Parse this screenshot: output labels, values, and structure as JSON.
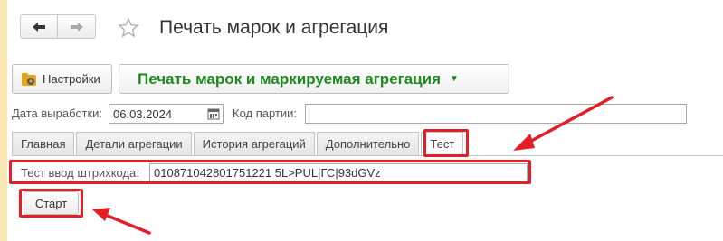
{
  "window": {
    "title": "Печать марок и агрегация"
  },
  "toolbar": {
    "settings_label": "Настройки",
    "main_menu_label": "Печать марок и маркируемая агрегация"
  },
  "form": {
    "date_label": "Дата выработки:",
    "date_value": "06.03.2024",
    "batch_label": "Код партии:",
    "batch_value": ""
  },
  "tabs": [
    {
      "label": "Главная",
      "active": false
    },
    {
      "label": "Детали агрегации",
      "active": false
    },
    {
      "label": "История агрегаций",
      "active": false
    },
    {
      "label": "Дополнительно",
      "active": false
    },
    {
      "label": "Тест",
      "active": true
    }
  ],
  "test": {
    "barcode_label": "Тест ввод штрихкода:",
    "barcode_value": "010871042801751221 5L>PUL|ГС|93dGVz",
    "start_label": "Старт"
  },
  "colors": {
    "accent_green": "#1d8a1d",
    "annotation_red": "#e41e26"
  },
  "icons": [
    "back-arrow-icon",
    "forward-arrow-icon",
    "favorite-star-icon",
    "settings-gear-icon",
    "calendar-icon",
    "dropdown-caret-icon"
  ]
}
